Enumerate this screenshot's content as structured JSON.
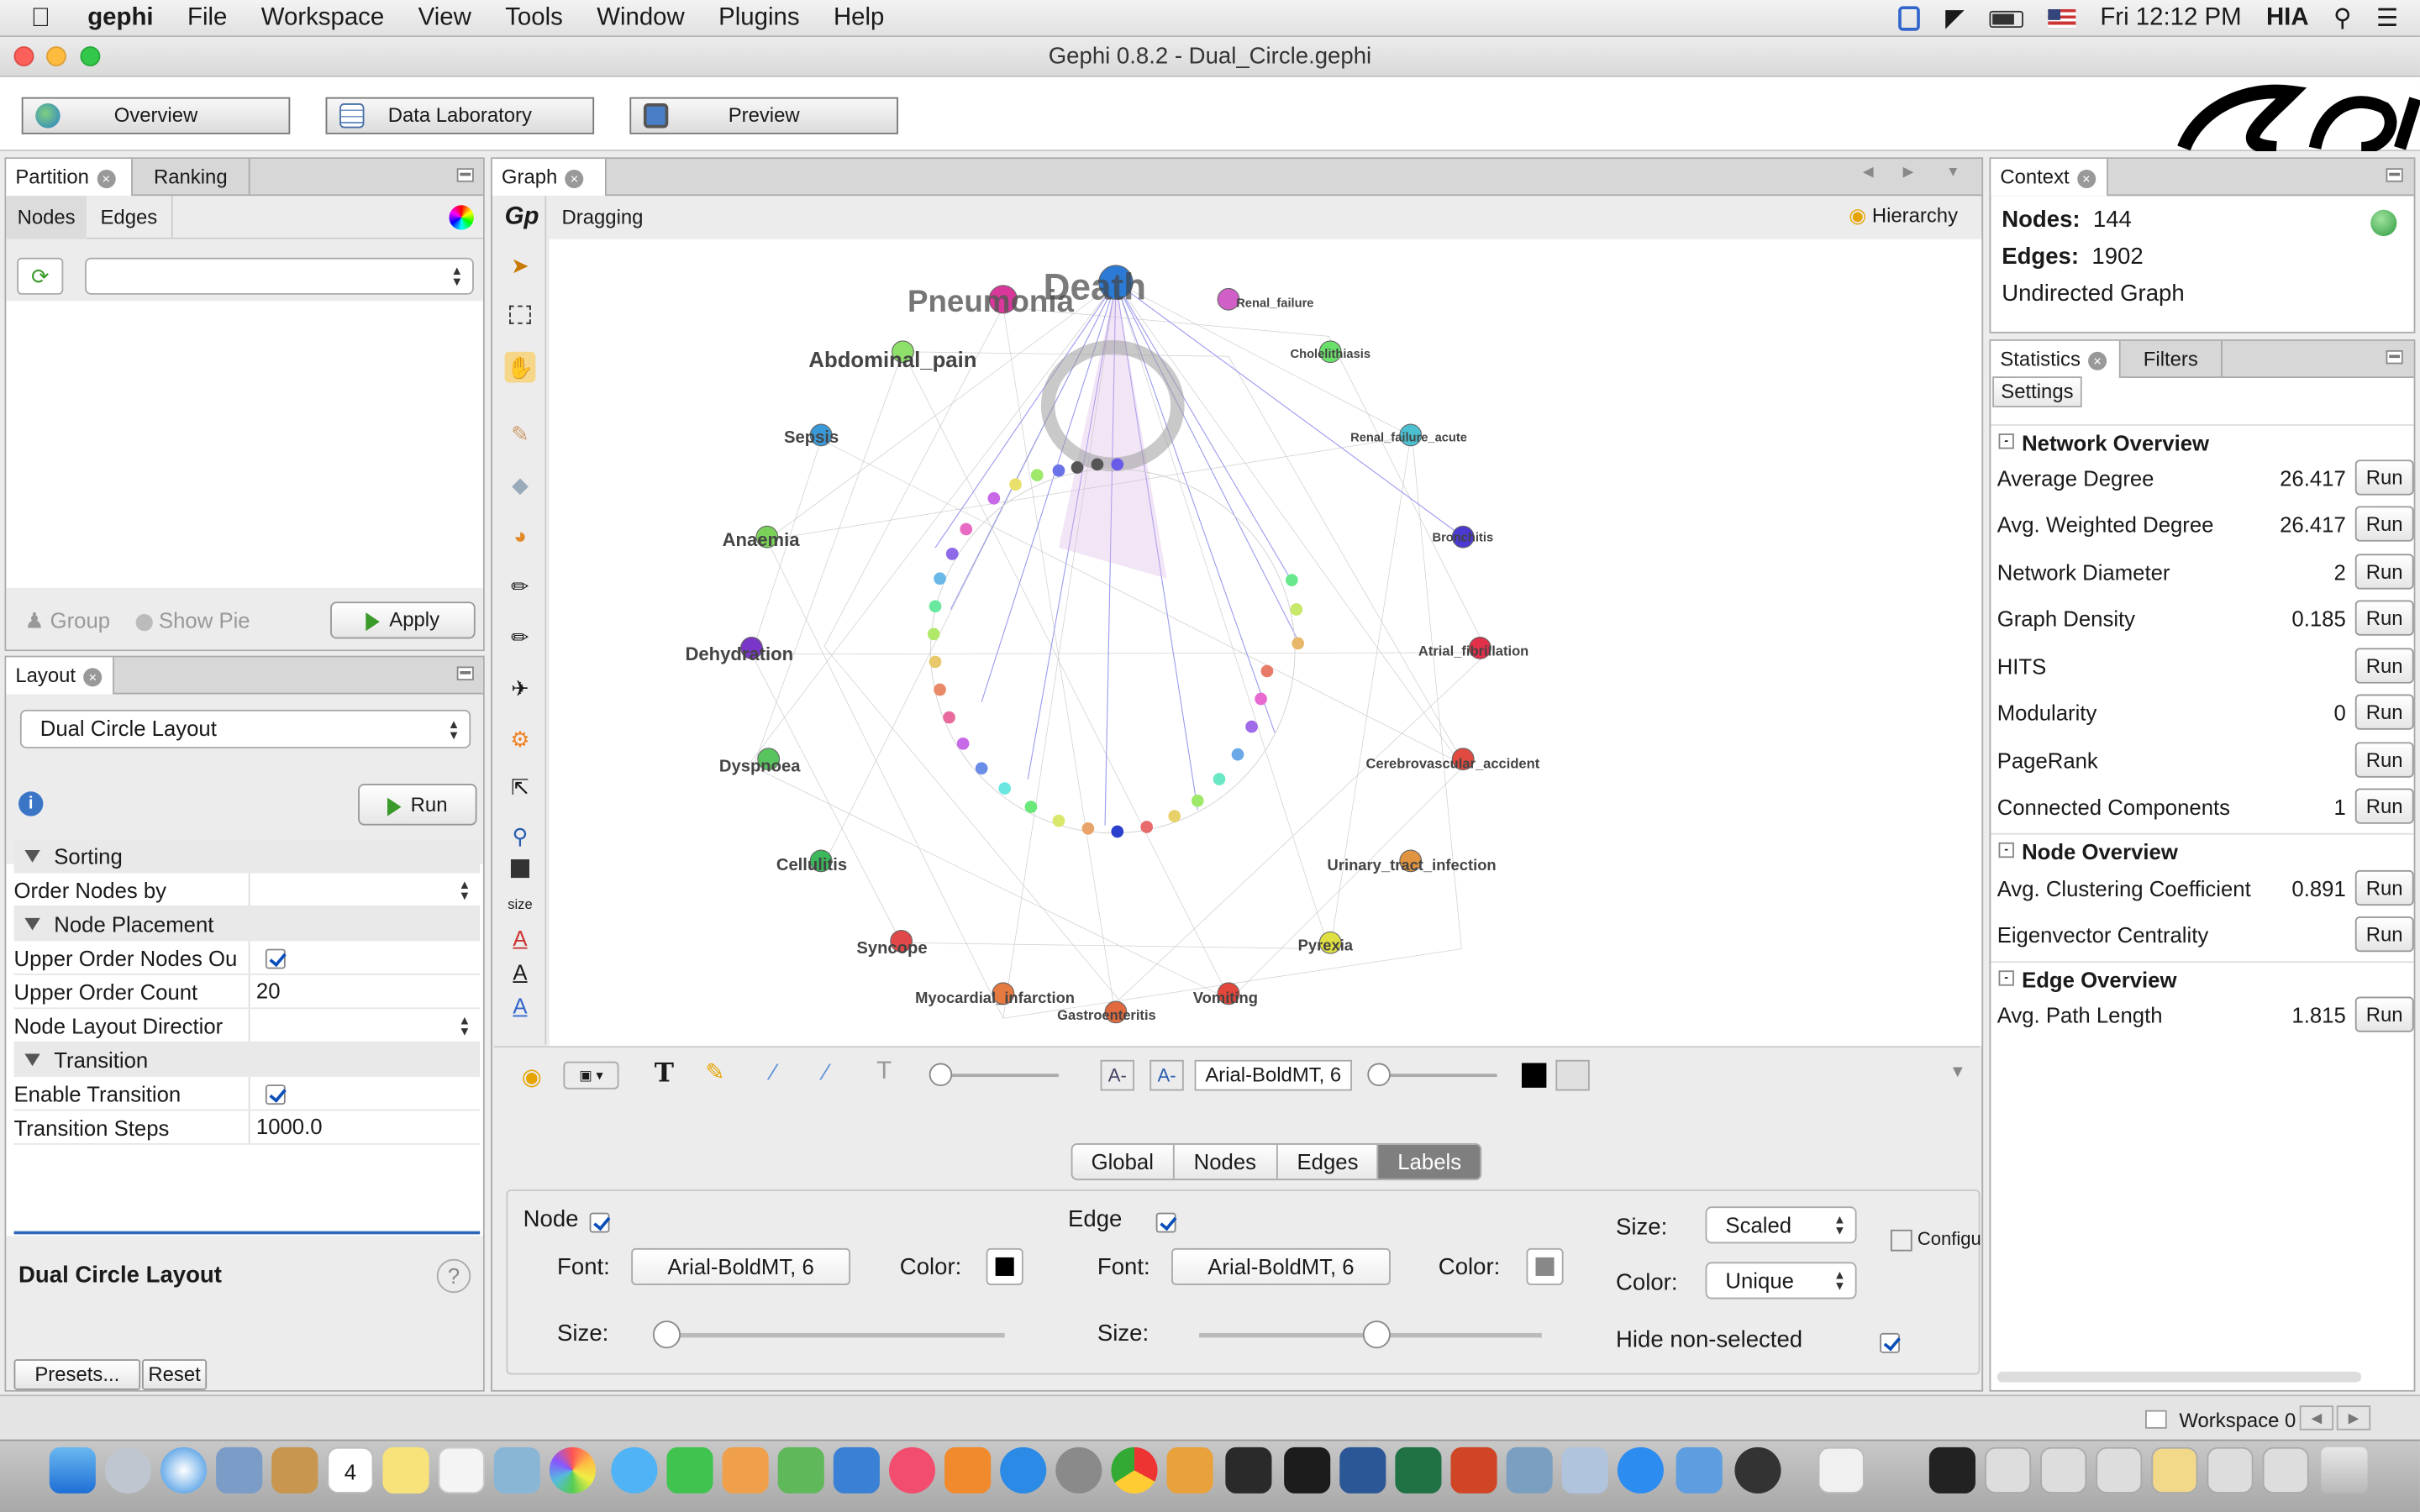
{
  "menubar": {
    "app": "gephi",
    "items": [
      "File",
      "Workspace",
      "View",
      "Tools",
      "Window",
      "Plugins",
      "Help"
    ],
    "clock": "Fri 12:12 PM",
    "user": "HIA"
  },
  "window": {
    "title": "Gephi 0.8.2 - Dual_Circle.gephi"
  },
  "toolbar": {
    "overview": "Overview",
    "data_lab": "Data Laboratory",
    "preview": "Preview"
  },
  "partition": {
    "tab1": "Partition",
    "tab2": "Ranking",
    "sub1": "Nodes",
    "sub2": "Edges",
    "group": "Group",
    "show_pie": "Show Pie",
    "apply": "Apply"
  },
  "layout": {
    "tab": "Layout",
    "algo": "Dual Circle Layout",
    "run": "Run",
    "sec_sorting": "Sorting",
    "order_nodes_by": "Order Nodes by",
    "sec_node_placement": "Node Placement",
    "upper_order_nodes": "Upper Order Nodes Ou",
    "upper_order_count_label": "Upper Order Count",
    "upper_order_count": "20",
    "node_layout_direction": "Node Layout Directior",
    "sec_transition": "Transition",
    "enable_transition": "Enable Transition",
    "transition_steps_label": "Transition Steps",
    "transition_steps": "1000.0",
    "desc_title": "Dual Circle Layout",
    "presets": "Presets...",
    "reset": "Reset"
  },
  "graph": {
    "tab": "Graph",
    "mode": "Dragging",
    "hierarchy": "Hierarchy",
    "size_label": "size",
    "font_value": "Arial-BoldMT, 6",
    "labels": {
      "pneumonia": "Pneumonia",
      "death": "Death",
      "abdominal": "Abdominal_pain",
      "sepsis": "Sepsis",
      "anaemia": "Anaemia",
      "dehydration": "Dehydration",
      "dyspnoea": "Dyspnoea",
      "cellulitis": "Cellulitis",
      "syncope": "Syncope",
      "myocardial": "Myocardial_infarction",
      "gastro": "Gastroenteritis",
      "vomiting": "Vomiting",
      "pyrexia": "Pyrexia",
      "uti": "Urinary_tract_infection",
      "cva": "Cerebrovascular_accident",
      "af": "Atrial_fibrillation",
      "bronchitis": "Bronchitis",
      "renal_acute": "Renal_failure_acute",
      "chole": "Cholelithiasis",
      "renal": "Renal_failure"
    }
  },
  "preview_props": {
    "tabs": [
      "Global",
      "Nodes",
      "Edges",
      "Labels"
    ],
    "node": "Node",
    "edge": "Edge",
    "font": "Font:",
    "color": "Color:",
    "size": "Size:",
    "node_font": "Arial-BoldMT, 6",
    "edge_font": "Arial-BoldMT, 6",
    "size_mode_label": "Size:",
    "size_mode": "Scaled",
    "color_mode_label": "Color:",
    "color_mode": "Unique",
    "hide_non_selected": "Hide non-selected",
    "configure": "Configu"
  },
  "context": {
    "tab": "Context",
    "nodes_label": "Nodes:",
    "nodes": "144",
    "edges_label": "Edges:",
    "edges": "1902",
    "type": "Undirected Graph"
  },
  "statistics": {
    "tab": "Statistics",
    "tab2": "Filters",
    "settings": "Settings",
    "run": "Run",
    "network_overview": "Network Overview",
    "node_overview": "Node Overview",
    "edge_overview": "Edge Overview",
    "rows": [
      {
        "name": "Average Degree",
        "value": "26.417"
      },
      {
        "name": "Avg. Weighted Degree",
        "value": "26.417"
      },
      {
        "name": "Network Diameter",
        "value": "2"
      },
      {
        "name": "Graph Density",
        "value": "0.185"
      },
      {
        "name": "HITS",
        "value": ""
      },
      {
        "name": "Modularity",
        "value": "0"
      },
      {
        "name": "PageRank",
        "value": ""
      },
      {
        "name": "Connected Components",
        "value": "1"
      },
      {
        "name": "Avg. Clustering Coefficient",
        "value": "0.891"
      },
      {
        "name": "Eigenvector Centrality",
        "value": ""
      },
      {
        "name": "Avg. Path Length",
        "value": "1.815"
      }
    ]
  },
  "status": {
    "workspace": "Workspace 0"
  }
}
